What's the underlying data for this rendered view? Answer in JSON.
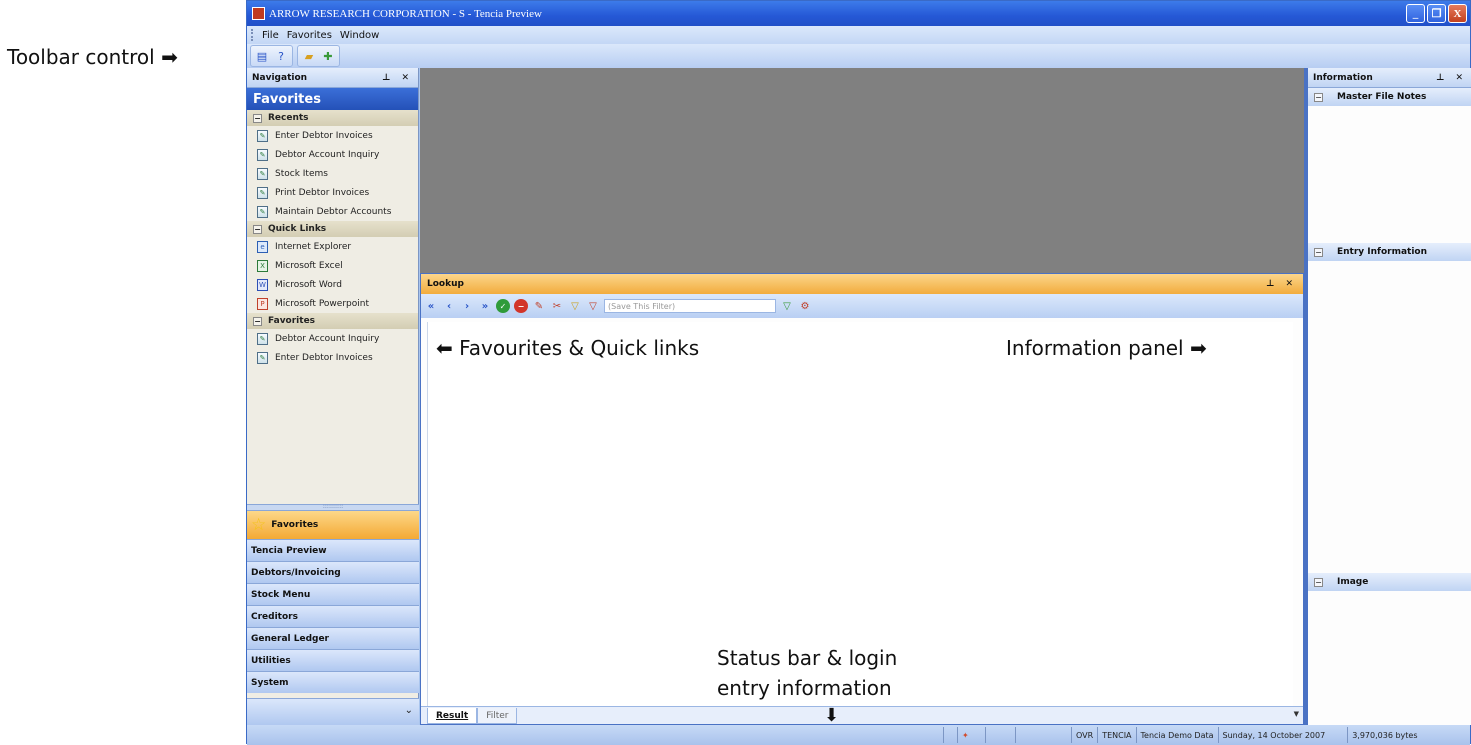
{
  "window": {
    "title": "ARROW RESEARCH CORPORATION - S - Tencia Preview",
    "buttons": {
      "minimize": "_",
      "restore": "❐",
      "close": "X"
    }
  },
  "menu": {
    "items": [
      "File",
      "Favorites",
      "Window"
    ]
  },
  "navigation": {
    "header": "Navigation",
    "favorites_title": "Favorites",
    "sections": [
      {
        "label": "Recents",
        "items": [
          "Enter Debtor Invoices",
          "Debtor Account Inquiry",
          "Stock Items",
          "Print Debtor Invoices",
          "Maintain Debtor Accounts"
        ]
      },
      {
        "label": "Quick Links",
        "items": [
          "Internet Explorer",
          "Microsoft Excel",
          "Microsoft Word",
          "Microsoft Powerpoint"
        ]
      },
      {
        "label": "Favorites",
        "items": [
          "Debtor Account Inquiry",
          "Enter Debtor Invoices"
        ]
      }
    ],
    "outlook_buttons": [
      "Favorites",
      "Tencia Preview",
      "Debtors/Invoicing",
      "Stock Menu",
      "Creditors",
      "General Ledger",
      "Utilities",
      "System"
    ]
  },
  "lookup": {
    "header": "Lookup",
    "filter_placeholder": "(Save This Filter)",
    "tabs": [
      "Result",
      "Filter"
    ]
  },
  "information": {
    "header": "Information",
    "sections": [
      "Master File Notes",
      "Entry Information",
      "Image"
    ]
  },
  "statusbar": {
    "mode": "OVR",
    "user": "TENCIA",
    "database": "Tencia Demo Data",
    "date": "Sunday, 14 October 2007",
    "memory": "3,970,036 bytes"
  },
  "callouts": {
    "toolbar": "Toolbar control ➡",
    "favourites": "⬅ Favourites & Quick links",
    "information": "Information panel ➡",
    "status_line1": "Status bar & login",
    "status_line2": "entry information",
    "status_arrow": "⬇"
  }
}
